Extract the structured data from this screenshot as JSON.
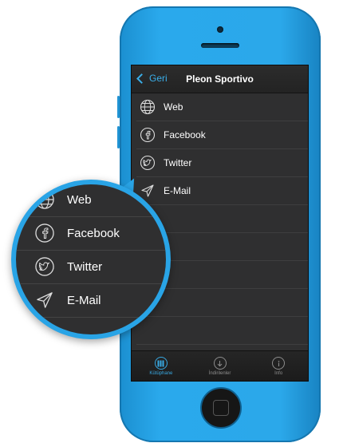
{
  "navbar": {
    "back_label": "Geri",
    "title": "Pleon Sportivo"
  },
  "list": {
    "items": [
      {
        "label": "Web",
        "icon": "globe-icon"
      },
      {
        "label": "Facebook",
        "icon": "facebook-icon"
      },
      {
        "label": "Twitter",
        "icon": "twitter-icon"
      },
      {
        "label": "E-Mail",
        "icon": "send-icon"
      }
    ]
  },
  "tabbar": {
    "tabs": [
      {
        "label": "Kütüphane",
        "icon": "library-icon",
        "active": true
      },
      {
        "label": "İndirilenler",
        "icon": "download-icon",
        "active": false
      },
      {
        "label": "Info",
        "icon": "info-icon",
        "active": false
      }
    ]
  },
  "magnifier": {
    "items": [
      {
        "label": "Web"
      },
      {
        "label": "Facebook"
      },
      {
        "label": "Twitter"
      },
      {
        "label": "E-Mail"
      }
    ]
  },
  "colors": {
    "accent": "#3aaee8",
    "phone": "#2aa9ec",
    "screen_bg": "#2f2f30"
  }
}
